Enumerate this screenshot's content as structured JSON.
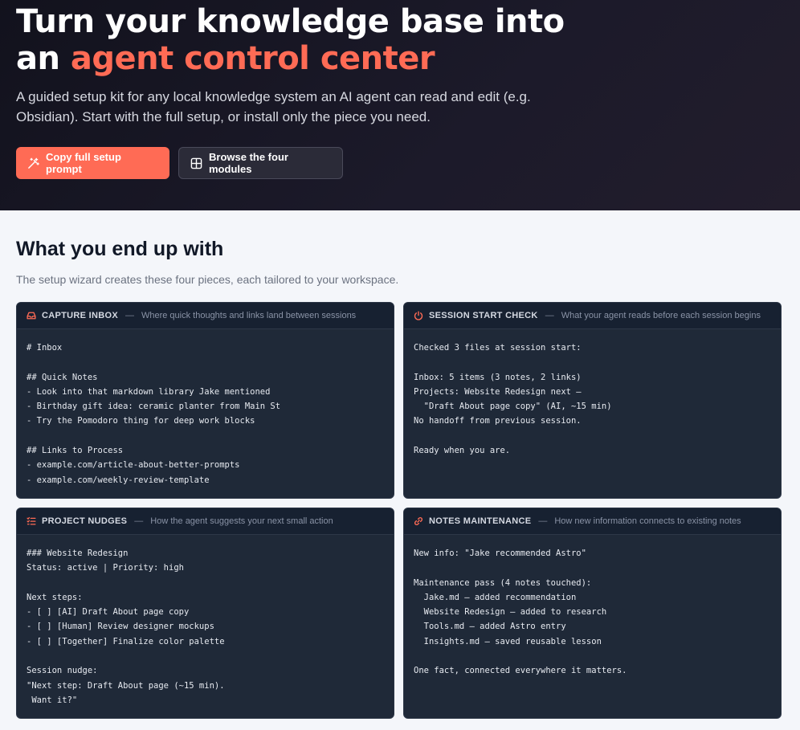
{
  "hero": {
    "title_line1": "Turn your knowledge base into",
    "title_prefix": "an ",
    "title_accent": "agent control center",
    "subtitle": "A guided setup kit for any local knowledge system an AI agent can read and edit (e.g. Obsidian). Start with the full setup, or install only the piece you need.",
    "primary_button": "Copy full setup prompt",
    "secondary_button": "Browse the four modules"
  },
  "section": {
    "title": "What you end up with",
    "subtitle": "The setup wizard creates these four pieces, each tailored to your workspace."
  },
  "cards": [
    {
      "name": "CAPTURE INBOX",
      "description": "Where quick thoughts and links land between sessions",
      "icon": "inbox-icon",
      "content": "# Inbox\n\n## Quick Notes\n- Look into that markdown library Jake mentioned\n- Birthday gift idea: ceramic planter from Main St\n- Try the Pomodoro thing for deep work blocks\n\n## Links to Process\n- example.com/article-about-better-prompts\n- example.com/weekly-review-template"
    },
    {
      "name": "SESSION START CHECK",
      "description": "What your agent reads before each session begins",
      "icon": "power-icon",
      "content": "Checked 3 files at session start:\n\nInbox: 5 items (3 notes, 2 links)\nProjects: Website Redesign next —\n  \"Draft About page copy\" (AI, ~15 min)\nNo handoff from previous session.\n\nReady when you are."
    },
    {
      "name": "PROJECT NUDGES",
      "description": "How the agent suggests your next small action",
      "icon": "list-checks-icon",
      "content": "### Website Redesign\nStatus: active | Priority: high\n\nNext steps:\n- [ ] [AI] Draft About page copy\n- [ ] [Human] Review designer mockups\n- [ ] [Together] Finalize color palette\n\nSession nudge:\n\"Next step: Draft About page (~15 min).\n Want it?\""
    },
    {
      "name": "NOTES MAINTENANCE",
      "description": "How new information connects to existing notes",
      "icon": "link-icon",
      "content": "New info: \"Jake recommended Astro\"\n\nMaintenance pass (4 notes touched):\n  Jake.md — added recommendation\n  Website Redesign — added to research\n  Tools.md — added Astro entry\n  Insights.md — saved reusable lesson\n\nOne fact, connected everywhere it matters."
    }
  ],
  "colors": {
    "accent": "#ff6b55",
    "hero_bg": "#14131f",
    "card_bg": "#1f2938",
    "page_bg": "#f4f6fa"
  }
}
